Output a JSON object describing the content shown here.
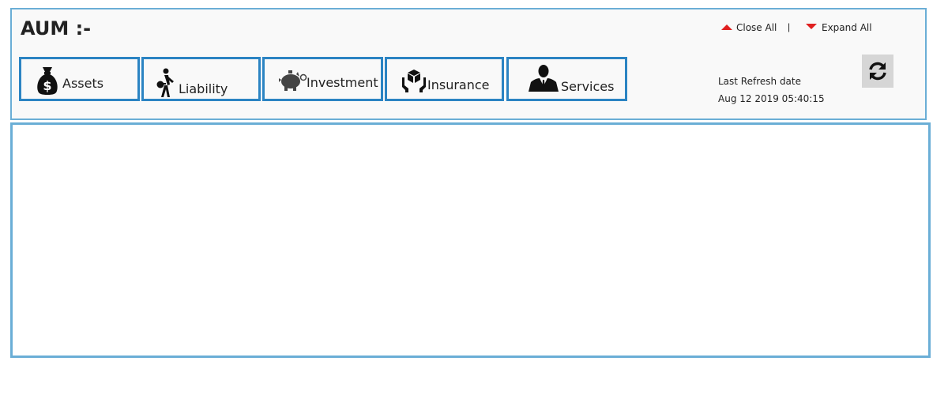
{
  "header": {
    "title": "AUM :-"
  },
  "controls": {
    "close_all": "Close All",
    "separator": "|",
    "expand_all": "Expand All"
  },
  "tabs": [
    {
      "label": "Assets",
      "icon": "money-bag-icon"
    },
    {
      "label": "Liability",
      "icon": "debtor-icon"
    },
    {
      "label": "Investment",
      "icon": "piggy-bank-icon"
    },
    {
      "label": "Insurance",
      "icon": "hands-box-icon"
    },
    {
      "label": "Services",
      "icon": "businessman-icon"
    }
  ],
  "refresh": {
    "label": "Last Refresh date",
    "value": "Aug 12 2019  05:40:15",
    "icon": "refresh-icon"
  },
  "colors": {
    "panel_border": "#6aaed6",
    "tab_border": "#2b84c3",
    "arrow": "#e02020"
  }
}
